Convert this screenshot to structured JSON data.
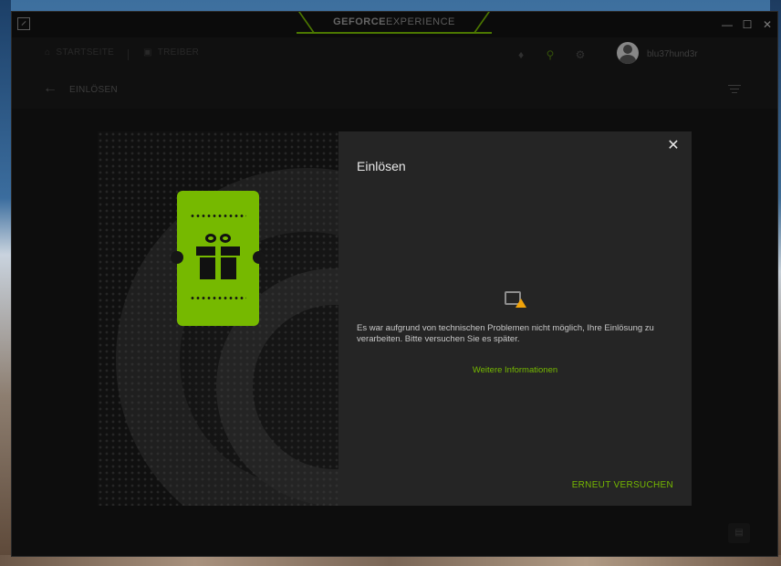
{
  "window": {
    "brand_bold": "GEFORCE",
    "brand_light": "EXPERIENCE"
  },
  "nav": {
    "home_label": "STARTSEITE",
    "drivers_label": "TREIBER",
    "username": "blu37hund3r"
  },
  "subheader": {
    "title": "EINLÖSEN"
  },
  "modal": {
    "title": "Einlösen",
    "error_message": "Es war aufgrund von technischen Problemen nicht möglich, Ihre Einlösung zu verarbeiten. Bitte versuchen Sie es später.",
    "more_info_link": "Weitere Informationen",
    "retry_button": "ERNEUT VERSUCHEN"
  },
  "colors": {
    "accent": "#76b900",
    "warning": "#f0a30a",
    "panel": "#252525"
  }
}
